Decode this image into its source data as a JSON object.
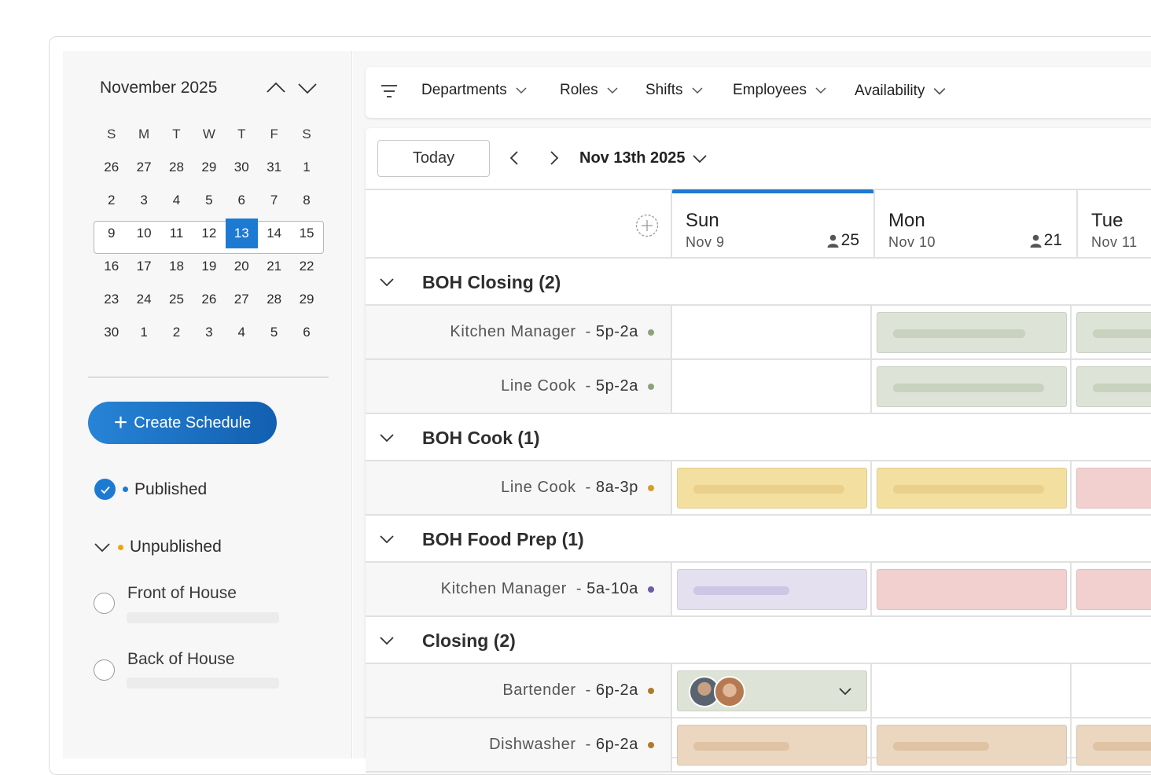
{
  "calendar": {
    "title": "November 2025",
    "weekdays": [
      "S",
      "M",
      "T",
      "W",
      "T",
      "F",
      "S"
    ],
    "weeks": [
      [
        "26",
        "27",
        "28",
        "29",
        "30",
        "31",
        "1"
      ],
      [
        "2",
        "3",
        "4",
        "5",
        "6",
        "7",
        "8"
      ],
      [
        "9",
        "10",
        "11",
        "12",
        "13",
        "14",
        "15"
      ],
      [
        "16",
        "17",
        "18",
        "19",
        "20",
        "21",
        "22"
      ],
      [
        "23",
        "24",
        "25",
        "26",
        "27",
        "28",
        "29"
      ],
      [
        "30",
        "1",
        "2",
        "3",
        "4",
        "5",
        "6"
      ]
    ],
    "selected_day": "13"
  },
  "sidebar": {
    "create_label": "Create Schedule",
    "published_label": "Published",
    "unpublished_label": "Unpublished",
    "schedules": [
      "Front of House",
      "Back of House"
    ]
  },
  "filters": {
    "items": [
      "Departments",
      "Roles",
      "Shifts",
      "Employees",
      "Availability"
    ]
  },
  "toolbar": {
    "today_label": "Today",
    "date_label": "Nov 13th 2025"
  },
  "days": [
    {
      "name": "Sun",
      "date": "Nov 9",
      "count": "25"
    },
    {
      "name": "Mon",
      "date": "Nov 10",
      "count": "21"
    },
    {
      "name": "Tue",
      "date": "Nov 11",
      "count": ""
    }
  ],
  "groups": [
    {
      "title": "BOH Closing (2)"
    },
    {
      "title": "BOH Cook (1)"
    },
    {
      "title": "BOH Food Prep (1)"
    },
    {
      "title": "Closing (2)"
    }
  ],
  "roles": [
    {
      "name": "Kitchen Manager",
      "time": "5p-2a"
    },
    {
      "name": "Line Cook",
      "time": "5p-2a"
    },
    {
      "name": "Line Cook",
      "time": "8a-3p"
    },
    {
      "name": "Kitchen Manager",
      "time": "5a-10a"
    },
    {
      "name": "Bartender",
      "time": "6p-2a"
    },
    {
      "name": "Dishwasher",
      "time": "6p-2a"
    }
  ],
  "colors": {
    "accent": "#1d7ad3",
    "published_dot": "#1d7ad3",
    "unpublished_dot": "#f0a500",
    "green_shift": "#dde3d6",
    "yellow_shift": "#f3dfa0",
    "pink_shift": "#f3d0d0",
    "purple_shift": "#e4e0f0",
    "tan_shift": "#ebd7c0"
  }
}
